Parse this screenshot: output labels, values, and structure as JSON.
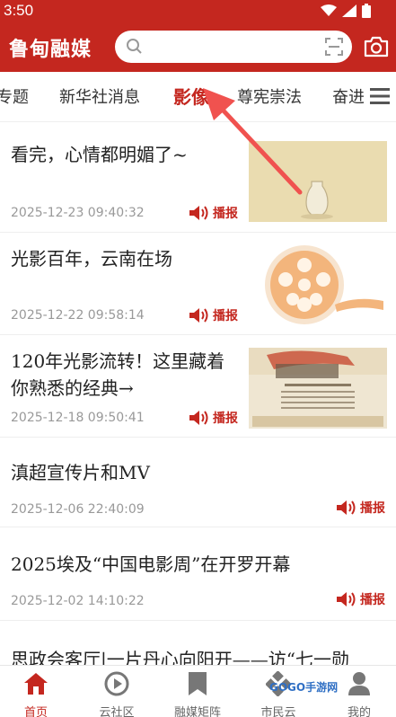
{
  "status_bar": {
    "time": "3:50"
  },
  "header": {
    "app_name": "鲁甸融媒",
    "search": {
      "placeholder": ""
    }
  },
  "tabs": [
    {
      "label": "专题",
      "active": false
    },
    {
      "label": "新华社消息",
      "active": false
    },
    {
      "label": "影像",
      "active": true
    },
    {
      "label": "尊宪崇法",
      "active": false
    },
    {
      "label": "奋进",
      "active": false
    }
  ],
  "news": [
    {
      "title": "看完，心情都明媚了~",
      "date": "2025-12-23 09:40:32",
      "broadcast": "播报",
      "thumbnail": "glass-vase"
    },
    {
      "title": "光影百年，云南在场",
      "date": "2025-12-22 09:58:14",
      "broadcast": "播报",
      "thumbnail": "film-reel"
    },
    {
      "title_line1": "120年光影流转！这里藏着",
      "title_line2": "你熟悉的经典→",
      "date": "2025-12-18 09:50:41",
      "broadcast": "播报",
      "thumbnail": "vintage-poster"
    },
    {
      "title": "滇超宣传片和MV",
      "date": "2025-12-06 22:40:09",
      "broadcast": "播报"
    },
    {
      "title": "2025埃及“中国电影周”在开罗开幕",
      "date": "2025-12-02 14:10:22",
      "broadcast": "播报"
    },
    {
      "title": "思政会客厅|一片丹心向阳开——访“七一勋"
    }
  ],
  "bottom_nav": [
    {
      "label": "首页",
      "icon": "home-icon",
      "active": true
    },
    {
      "label": "云社区",
      "icon": "play-circle-icon",
      "active": false
    },
    {
      "label": "融媒矩阵",
      "icon": "bookmark-icon",
      "active": false
    },
    {
      "label": "市民云",
      "icon": "grid-diamond-icon",
      "active": false
    },
    {
      "label": "我的",
      "icon": "person-icon",
      "active": false
    }
  ],
  "watermark": "GOGO手游网",
  "colors": {
    "brand_red": "#c4271f",
    "text_dark": "#222222",
    "text_muted": "#999999",
    "arrow_red": "#f0524f"
  }
}
